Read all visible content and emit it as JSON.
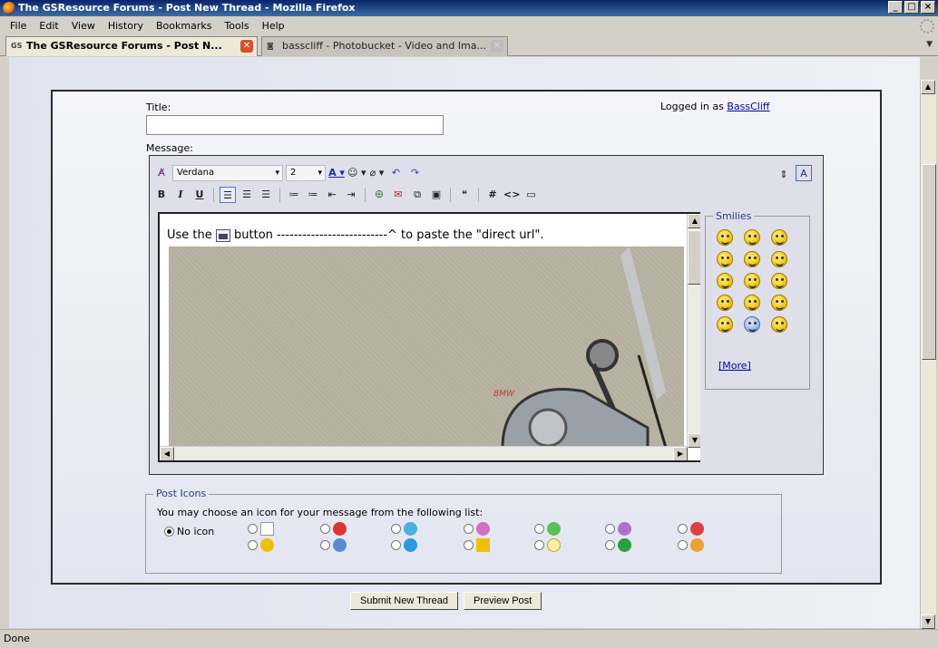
{
  "window": {
    "title": "The GSResource Forums - Post New Thread - Mozilla Firefox",
    "min": "_",
    "max": "□",
    "close": "×"
  },
  "menu": [
    "File",
    "Edit",
    "View",
    "History",
    "Bookmarks",
    "Tools",
    "Help"
  ],
  "tabs": [
    {
      "label": "The GSResource Forums - Post N...",
      "favicon": "GS",
      "active": true
    },
    {
      "label": "basscliff - Photobucket - Video and Ima...",
      "favicon": "",
      "active": false
    }
  ],
  "form": {
    "title_label": "Title:",
    "title_value": "",
    "logged_prefix": "Logged in as",
    "logged_user": "BassCliff",
    "message_label": "Message:"
  },
  "editor": {
    "font": "Verdana",
    "size": "2",
    "text_before": "Use the",
    "text_after": "button --------------------------^ to paste the \"direct url\".",
    "toolbar_row2": [
      "B",
      "I",
      "U"
    ]
  },
  "smilies": {
    "legend": "Smilies",
    "more_label": "[More]"
  },
  "post_icons": {
    "legend": "Post Icons",
    "instruction": "You may choose an icon for your message from the following list:",
    "no_icon_label": "No icon"
  },
  "buttons": {
    "submit": "Submit New Thread",
    "preview": "Preview Post"
  },
  "status": "Done",
  "colors": {
    "titlebar": "#0a246a",
    "link": "#0000aa",
    "legend": "#2a3a8a"
  }
}
